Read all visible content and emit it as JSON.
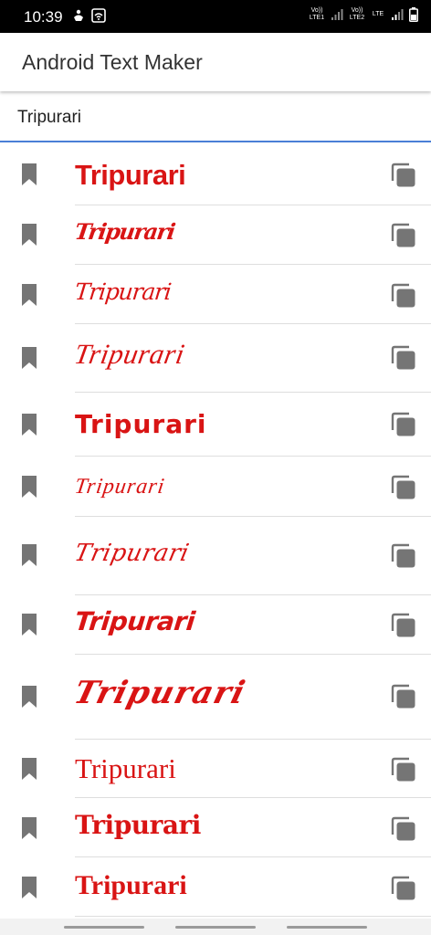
{
  "status_bar": {
    "time": "10:39",
    "sim1_tag": "Vo)) LTE1",
    "sim2_tag": "Vo)) LTE2",
    "lte_tag": "LTE"
  },
  "app": {
    "title": "Android Text Maker"
  },
  "input": {
    "value": "Tripurari"
  },
  "styles": [
    {
      "text": "Tripurari"
    },
    {
      "text": "Tripurari"
    },
    {
      "text": "Tripurari"
    },
    {
      "text": "Tripurari"
    },
    {
      "text": "Tripurari"
    },
    {
      "text": "Tripurari"
    },
    {
      "text": "Tripurari"
    },
    {
      "text": "Tripurari"
    },
    {
      "text": "Tripurari"
    },
    {
      "text": "Tripurari"
    },
    {
      "text": "Tripurari"
    },
    {
      "text": "Tripurari"
    }
  ],
  "colors": {
    "accent_text": "#d91414",
    "input_underline": "#4a7fd6",
    "icon_gray": "#757575"
  },
  "icons": {
    "row_leading": "bookmark-icon",
    "row_trailing": "copy-icon"
  }
}
